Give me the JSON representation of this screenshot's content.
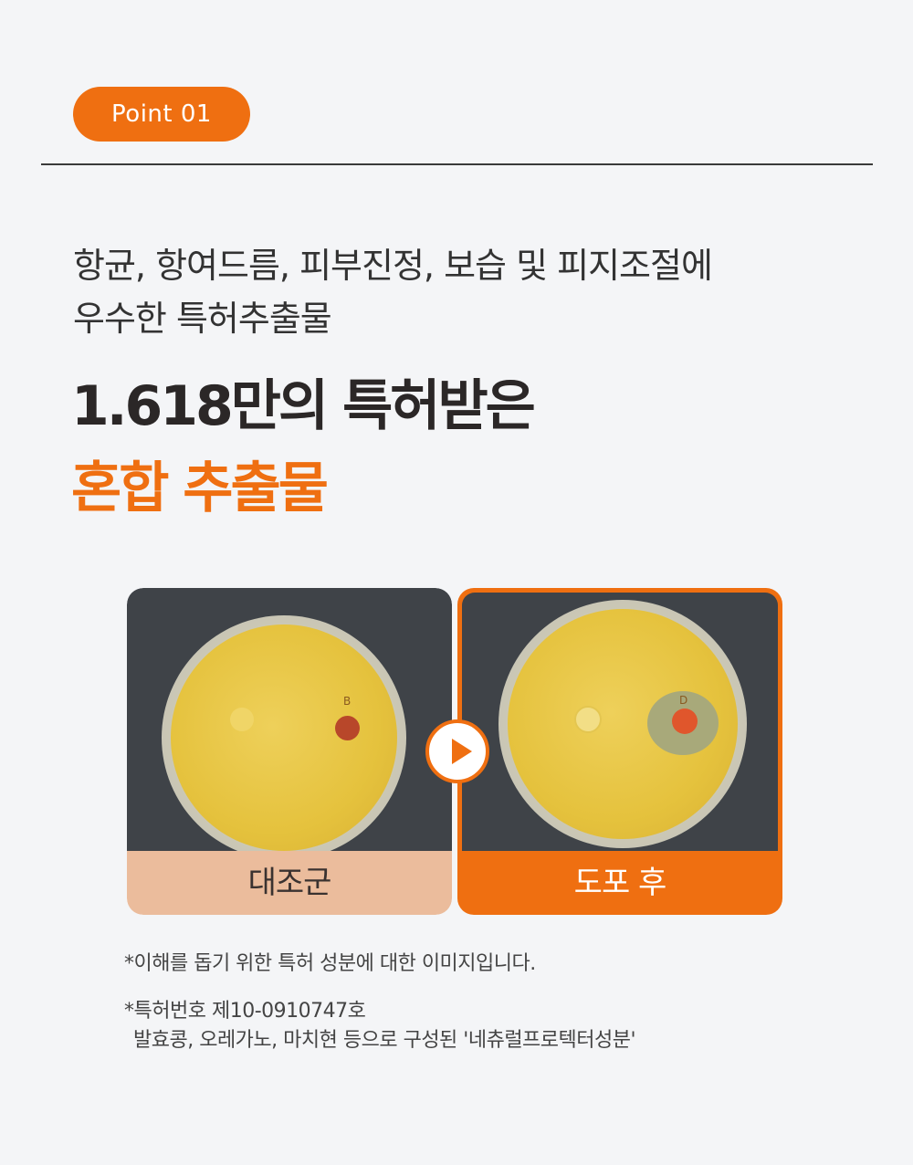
{
  "badge": {
    "label": "Point 01"
  },
  "subhead": {
    "line1": "항균, 항여드름, 피부진정, 보습 및 피지조절에",
    "line2": "우수한 특허추출물"
  },
  "headline": {
    "line1": "1.618만의 특허받은",
    "line2": "혼합 추출물"
  },
  "comparison": {
    "before": {
      "label": "대조군",
      "plate_mark": "B"
    },
    "after": {
      "label": "도포 후",
      "plate_mark": "D"
    },
    "arrow_icon": "play-icon"
  },
  "notes": {
    "note1": "*이해를 돕기 위한 특허 성분에 대한 이미지입니다.",
    "note2": "*특허번호 제10-0910747호",
    "note3": "발효콩, 오레가노, 마치현 등으로 구성된 '네츄럴프로텍터성분'"
  },
  "colors": {
    "accent": "#ef6f11",
    "before_label_bg": "#ebbc9c",
    "background": "#f4f5f7"
  }
}
